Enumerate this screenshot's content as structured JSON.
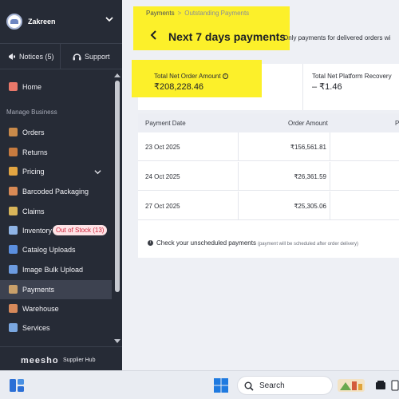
{
  "sidebar": {
    "account_name": "Zakreen",
    "notices_label": "Notices (5)",
    "support_label": "Support",
    "home_label": "Home",
    "section_label": "Manage Business",
    "items": [
      {
        "label": "Orders",
        "icon": "box-icon"
      },
      {
        "label": "Returns",
        "icon": "return-box-icon"
      },
      {
        "label": "Pricing",
        "icon": "price-tag-icon"
      },
      {
        "label": "Barcoded Packaging",
        "icon": "package-icon"
      },
      {
        "label": "Claims",
        "icon": "claims-icon"
      },
      {
        "label": "Inventory",
        "icon": "inventory-icon",
        "badge": "Out of Stock (13)"
      },
      {
        "label": "Catalog Uploads",
        "icon": "upload-icon"
      },
      {
        "label": "Image Bulk Upload",
        "icon": "image-icon"
      },
      {
        "label": "Payments",
        "icon": "wallet-icon",
        "active": true
      },
      {
        "label": "Warehouse",
        "icon": "warehouse-icon"
      },
      {
        "label": "Services",
        "icon": "services-icon"
      }
    ],
    "brand_logo": "meesho",
    "brand_sub": "Supplier Hub"
  },
  "header": {
    "breadcrumb_root": "Payments",
    "breadcrumb_current": "Outstanding Payments",
    "title": "Next 7 days payments",
    "subtitle": "Only payments for delivered orders wi"
  },
  "summary": {
    "net_order_label": "Total Net Order Amount",
    "net_order_value": "₹208,228.46",
    "platform_label": "Total Net Platform Recovery",
    "platform_value": "– ₹1.46"
  },
  "table": {
    "columns": [
      "Payment Date",
      "Order Amount",
      "P"
    ],
    "rows": [
      {
        "date": "23 Oct 2025",
        "amount": "₹156,561.81"
      },
      {
        "date": "24 Oct 2025",
        "amount": "₹26,361.59"
      },
      {
        "date": "27 Oct 2025",
        "amount": "₹25,305.06"
      }
    ],
    "footnote": "Check your unscheduled payments",
    "footnote_small": "(payment will be scheduled after order delivery)"
  },
  "taskbar": {
    "search_label": "Search"
  },
  "colors": {
    "sidebar_bg": "#262b36",
    "highlight": "#fcf02a",
    "badge_text": "#d0233a",
    "badge_bg": "#fde3e6"
  }
}
